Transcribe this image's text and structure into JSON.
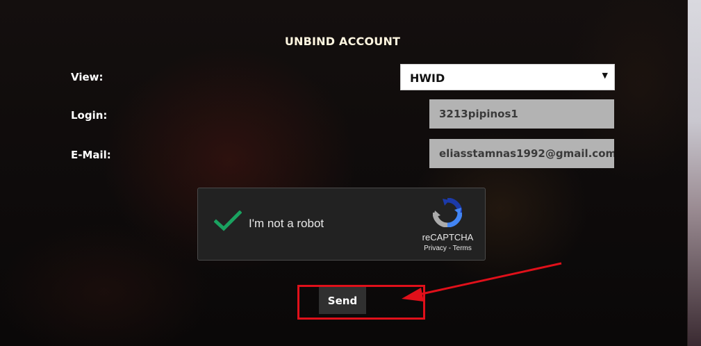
{
  "form": {
    "title": "UNBIND ACCOUNT",
    "view_label": "View:",
    "view_value": "HWID",
    "login_label": "Login:",
    "login_value": "3213pipinos1",
    "email_label": "E-Mail:",
    "email_value": "eliasstamnas1992@gmail.com"
  },
  "captcha": {
    "label": "I'm not a robot",
    "brand": "reCAPTCHA",
    "privacy": "Privacy",
    "separator": " - ",
    "terms": "Terms"
  },
  "actions": {
    "send_label": "Send"
  },
  "colors": {
    "annotation": "#e0101a",
    "check": "#1aa260",
    "field_bg": "#b3b3b3",
    "button_bg": "#303030"
  },
  "icons": [
    "chevron-down-icon",
    "checkmark-icon",
    "recaptcha-logo-icon",
    "arrow-annotation-icon"
  ]
}
